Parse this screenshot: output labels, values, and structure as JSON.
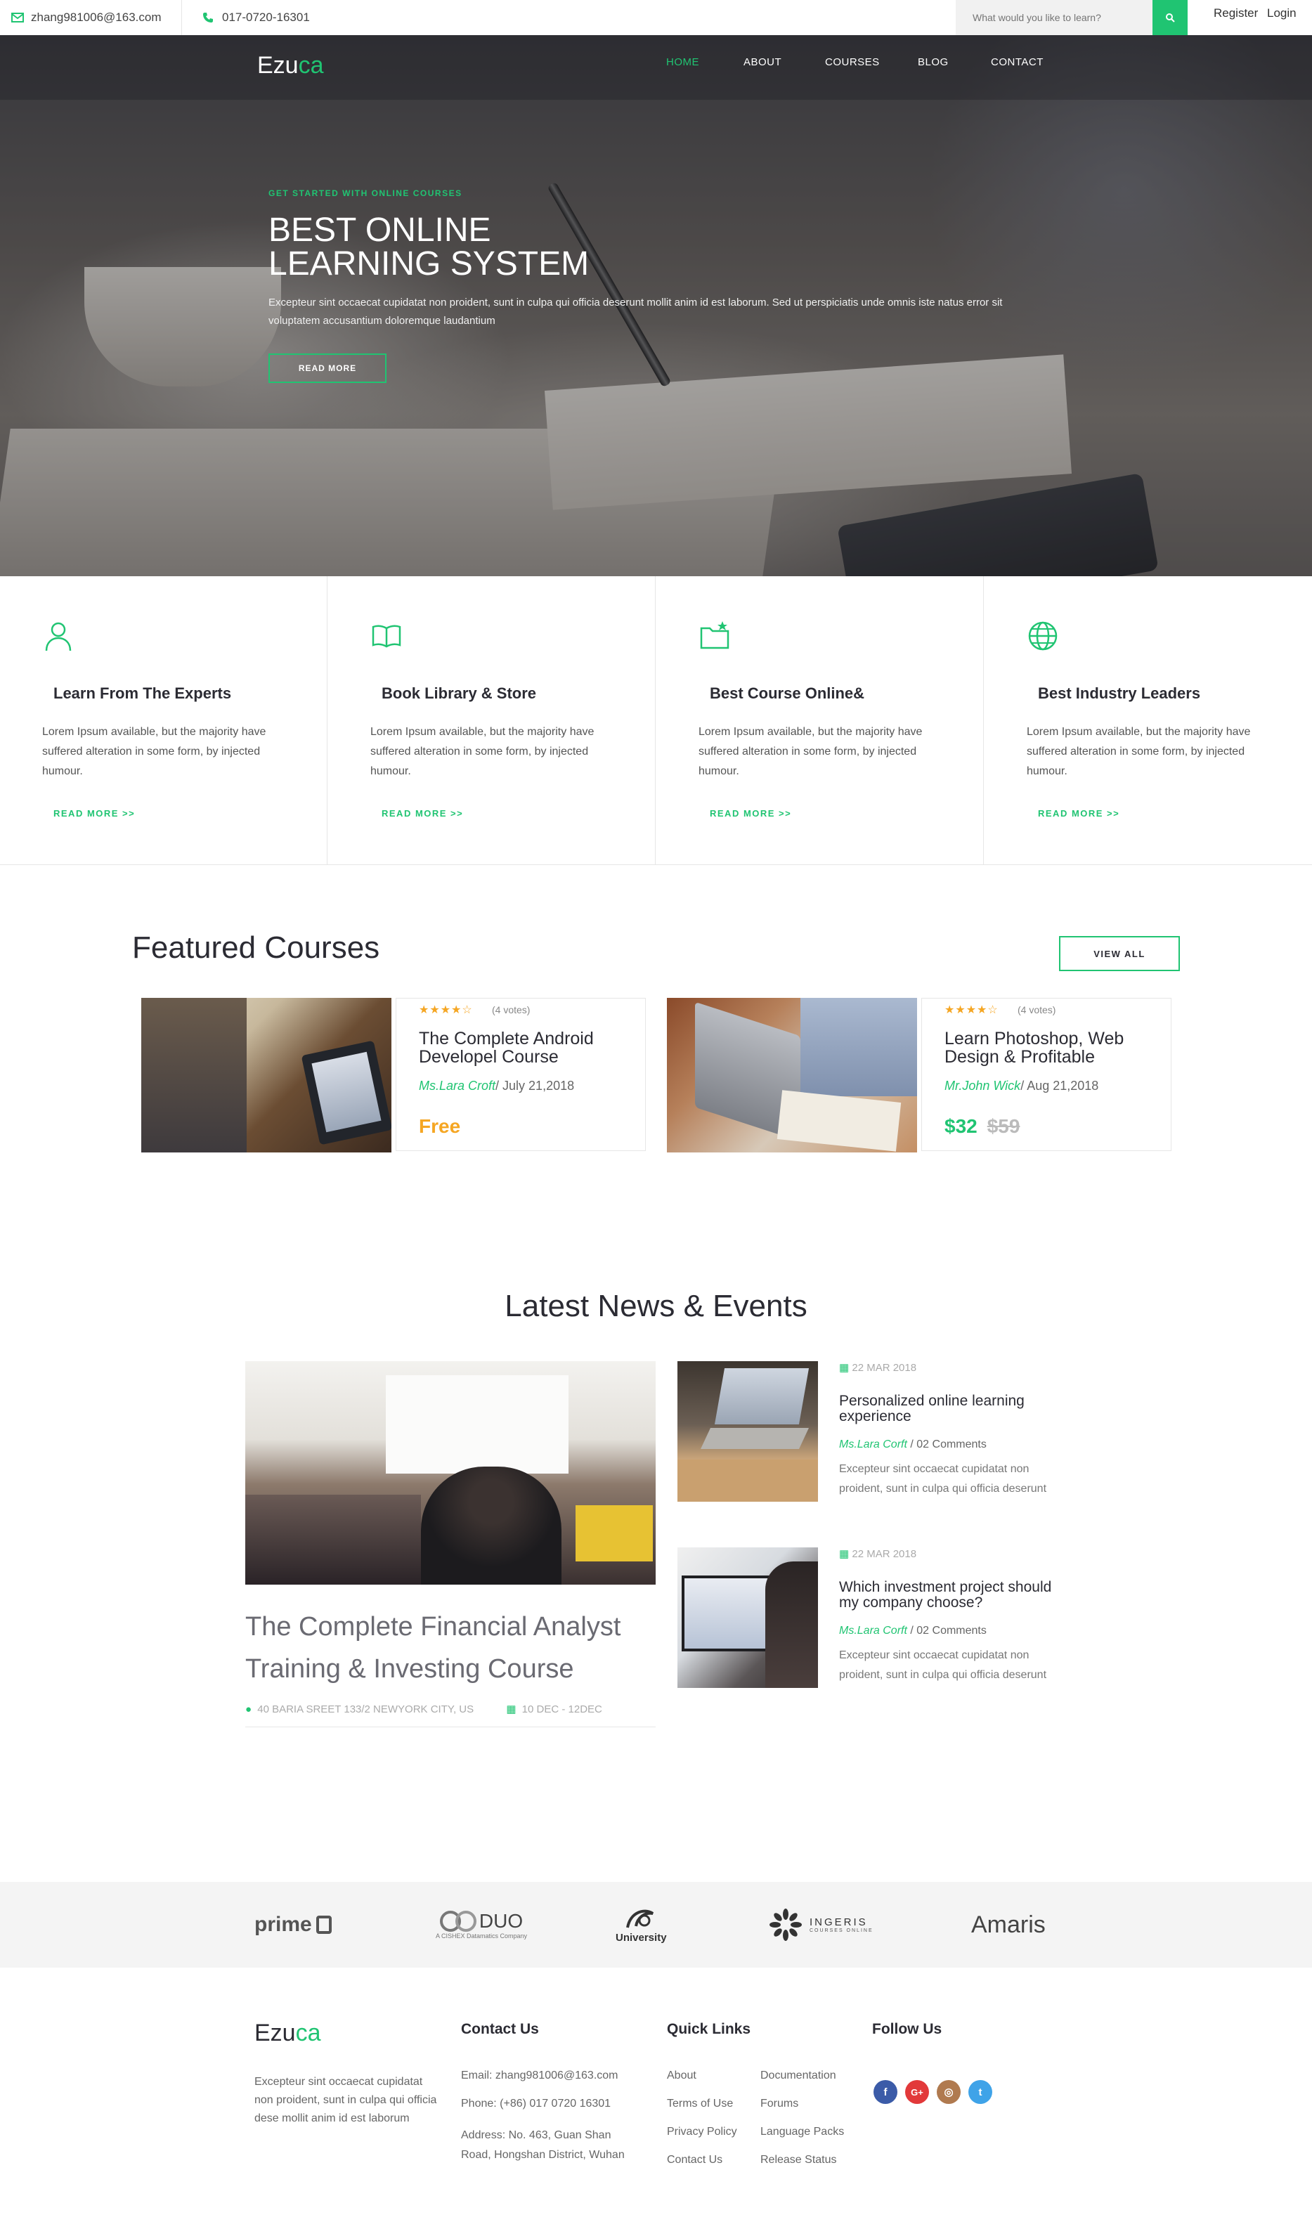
{
  "topbar": {
    "email": "zhang981006@163.com",
    "phone": "017-0720-16301",
    "search_placeholder": "What would you like to learn?",
    "register": "Register",
    "login": "Login"
  },
  "nav": {
    "logo_a": "Ezu",
    "logo_b": "ca",
    "items": [
      "HOME",
      "ABOUT",
      "COURSES",
      "BLOG",
      "CONTACT"
    ]
  },
  "hero": {
    "tag": "GET STARTED WITH ONLINE COURSES",
    "title_line1": "BEST ONLINE",
    "title_line2": "LEARNING SYSTEM",
    "text_line1": "Excepteur sint occaecat cupidatat non proident, sunt in culpa qui officia deserunt mollit anim id est laborum. Sed ut perspiciatis unde omnis iste natus error sit",
    "text_line2": "voluptatem accusantium doloremque laudantium",
    "button": "READ MORE"
  },
  "features": [
    {
      "icon": "user-icon",
      "title": "Learn From The Experts",
      "text": "Lorem Ipsum available, but the majority have suffered alteration in some form, by injected humour.",
      "more": "READ MORE >>"
    },
    {
      "icon": "book-icon",
      "title": "Book Library & Store",
      "text": "Lorem Ipsum available, but the majority have suffered alteration in some form, by injected humour.",
      "more": "READ MORE >>"
    },
    {
      "icon": "folder-star-icon",
      "title": "Best Course Online&",
      "text": "Lorem Ipsum available, but the majority have suffered alteration in some form, by injected humour.",
      "more": "READ MORE >>"
    },
    {
      "icon": "globe-icon",
      "title": "Best Industry Leaders",
      "text": "Lorem Ipsum available, but the majority have suffered alteration in some form, by injected humour.",
      "more": "READ MORE >>"
    }
  ],
  "featured": {
    "title": "Featured Courses",
    "view_all": "VIEW ALL",
    "courses": [
      {
        "stars": "★★★★☆",
        "votes": "(4 votes)",
        "title": "The Complete Android Developel Course",
        "author": "Ms.Lara Croft",
        "date": "/ July 21,2018",
        "price": "Free",
        "old_price": ""
      },
      {
        "stars": "★★★★☆",
        "votes": "(4 votes)",
        "title": "Learn Photoshop, Web Design & Profitable",
        "author": "Mr.John Wick",
        "date": "/ Aug 21,2018",
        "price": "$32",
        "old_price": "$59"
      }
    ]
  },
  "news": {
    "title": "Latest News & Events",
    "big": {
      "title": "The Complete Financial Analyst Training & Investing Course",
      "location": "40 BARIA SREET 133/2 NEWYORK CITY, US",
      "date": "10 DEC - 12DEC"
    },
    "items": [
      {
        "date": "22 MAR 2018",
        "title": "Personalized online learning experience",
        "author": "Ms.Lara Corft",
        "comments": "/ 02 Comments",
        "text": "Excepteur sint occaecat cupidatat non proident, sunt in culpa qui officia deserunt"
      },
      {
        "date": "22 MAR 2018",
        "title": "Which investment project should my company choose?",
        "author": "Ms.Lara Corft",
        "comments": "/ 02 Comments",
        "text": "Excepteur sint occaecat cupidatat non proident, sunt in culpa qui officia deserunt"
      }
    ]
  },
  "partners": {
    "prime": "prime",
    "duo": "DUO",
    "duo_sub": "A CISHEX Datamatics Company",
    "university": "University",
    "ingeris": "INGERIS",
    "ingeris_sub": "COURSES ONLINE",
    "amaris": "Amaris"
  },
  "footer": {
    "about_text": "Excepteur sint occaecat cupidatat non proident, sunt in culpa qui officia dese mollit anim id est laborum",
    "contact_title": "Contact Us",
    "email": "Email: zhang981006@163.com",
    "phone": "Phone: (+86) 017 0720 16301",
    "address_line1": "Address: No. 463, Guan Shan",
    "address_line2": "Road, Hongshan District, Wuhan",
    "links_title": "Quick Links",
    "links_col1": [
      "About",
      "Terms of Use",
      "Privacy Policy",
      "Contact Us"
    ],
    "links_col2": [
      "Documentation",
      "Forums",
      "Language Packs",
      "Release Status"
    ],
    "follow_title": "Follow Us",
    "social": [
      {
        "icon": "facebook-icon",
        "glyph": "f",
        "color": "#3b5ba8"
      },
      {
        "icon": "google-plus-icon",
        "glyph": "G+",
        "color": "#e2393a"
      },
      {
        "icon": "instagram-icon",
        "glyph": "◎",
        "color": "#b07a4f"
      },
      {
        "icon": "twitter-icon",
        "glyph": "t",
        "color": "#3fa3e8"
      }
    ]
  },
  "colors": {
    "accent": "#20c472",
    "price_free": "#f5a623",
    "text_dark": "#2b2b33"
  }
}
